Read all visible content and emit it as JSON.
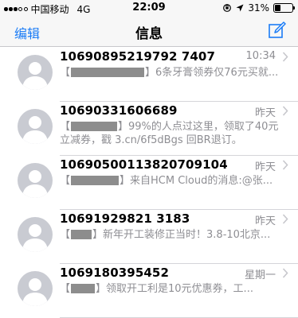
{
  "status_bar": {
    "carrier": "中国移动",
    "network": "4G",
    "time": "22:09",
    "battery_text": "31%",
    "battery_level": 0.31
  },
  "nav": {
    "edit_label": "编辑",
    "title": "信息",
    "compose_icon": "compose-icon"
  },
  "messages": [
    {
      "sender": "10690895219792 7407",
      "time": "10:34",
      "pre": "【",
      "post": "】6条牙膏领券仅76元买就..."
    },
    {
      "sender": "10690331606689",
      "time": "昨天",
      "pre": "【",
      "post": "】99%的人点过这里，领取了40元立减券，戳  3.cn/6f5dBgs   回BR退订。"
    },
    {
      "sender": "10690500113820709104",
      "time": "昨天",
      "pre": "【",
      "post": "】来自HCM Cloud的消息:@张..."
    },
    {
      "sender": "10691929821 3183",
      "time": "昨天",
      "pre": "【",
      "post": "】新年开工装修正当时！3.8-10北京..."
    },
    {
      "sender": "1069180395452",
      "time": "星期一",
      "pre": "【",
      "post": "】领取开工利是10元优惠券，工..."
    }
  ],
  "colors": {
    "accent": "#1b7cf6",
    "secondary_text": "#8e8e93",
    "bar_bg": "#f7f7f7"
  }
}
